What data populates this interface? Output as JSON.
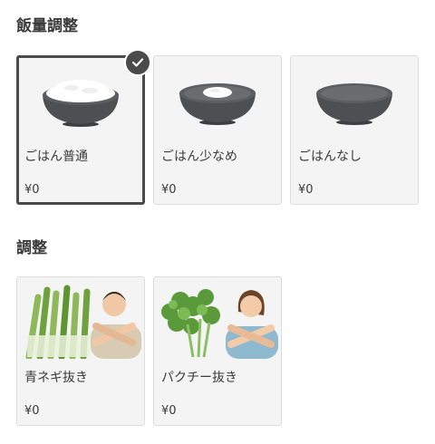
{
  "rice_section": {
    "title": "飯量調整",
    "options": [
      {
        "name": "ごはん普通",
        "price": "¥0",
        "icon": "rice-bowl-full-icon",
        "selected": true
      },
      {
        "name": "ごはん少なめ",
        "price": "¥0",
        "icon": "rice-bowl-small-icon",
        "selected": false
      },
      {
        "name": "ごはんなし",
        "price": "¥0",
        "icon": "rice-bowl-empty-icon",
        "selected": false
      }
    ]
  },
  "adjust_section": {
    "title": "調整",
    "options": [
      {
        "name": "青ネギ抜き",
        "price": "¥0",
        "icon": "green-onion-no-icon"
      },
      {
        "name": "パクチー抜き",
        "price": "¥0",
        "icon": "cilantro-no-icon"
      }
    ]
  },
  "colors": {
    "card_bg": "#f4f4f4",
    "card_border": "#dedede",
    "selected_border": "#4a4a4a",
    "bowl": "#4d4f52",
    "rice": "#ffffff"
  }
}
